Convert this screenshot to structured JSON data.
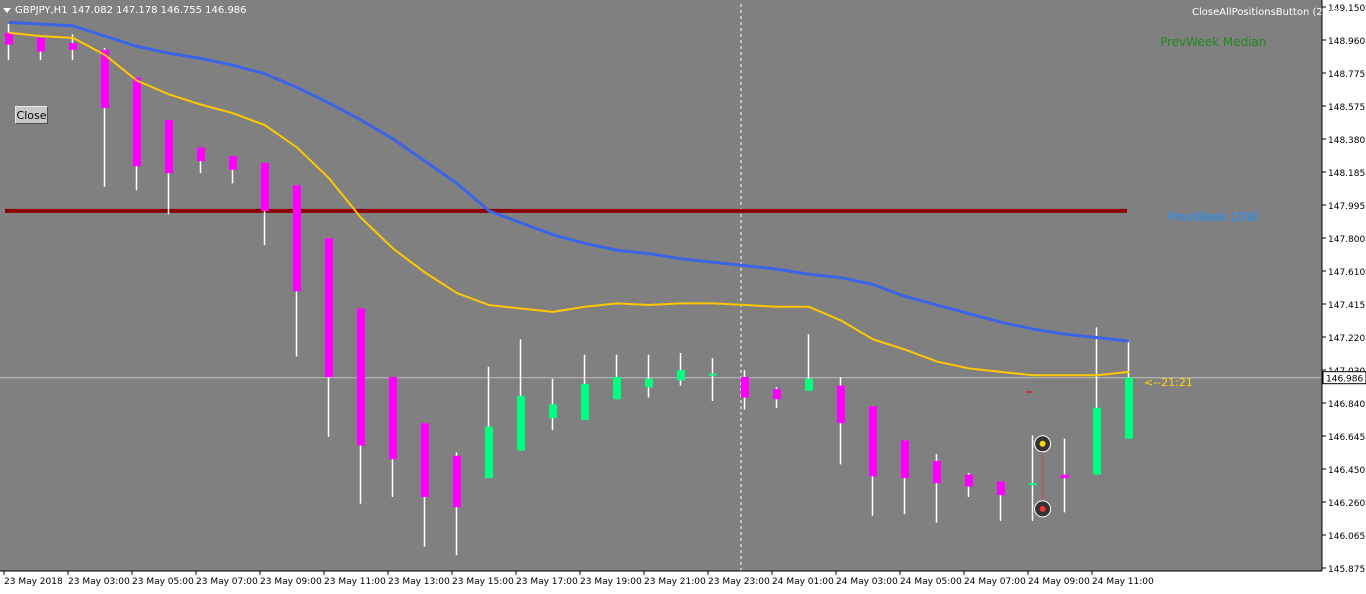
{
  "header": {
    "symbol": "GBPJPY,H1",
    "ohlc": "147.082 147.178 146.755 146.986"
  },
  "buttons": {
    "close_label": "Close",
    "close_all_label": "CloseAllPositionsButton (2)"
  },
  "labels": {
    "prev_week_median": "PrevWeek Median",
    "prev_week_low": "PrevWeek LOW",
    "bar_timer": "<--21:21"
  },
  "colors": {
    "background": "#808080",
    "bull": "#00ff7f",
    "bear": "#ff00ff",
    "wick": "#ffffff",
    "ma_fast": "#ffc800",
    "ma_slow": "#3c64e6",
    "prev_week_low_line": "#8b0000",
    "bid_line": "#c0c0c0",
    "axis_bg": "#ffffff"
  },
  "chart_data": {
    "type": "candlestick",
    "timeframe": "H1",
    "ylim": [
      145.875,
      149.15
    ],
    "y_ticks": [
      "149.150",
      "148.960",
      "148.775",
      "148.575",
      "148.380",
      "148.185",
      "147.995",
      "147.800",
      "147.610",
      "147.415",
      "147.220",
      "147.030",
      "146.840",
      "146.645",
      "146.450",
      "146.260",
      "146.065",
      "145.875"
    ],
    "x_tick_labels": [
      "23 May 2018",
      "23 May 03:00",
      "23 May 05:00",
      "23 May 07:00",
      "23 May 09:00",
      "23 May 11:00",
      "23 May 13:00",
      "23 May 15:00",
      "23 May 17:00",
      "23 May 19:00",
      "23 May 21:00",
      "23 May 23:00",
      "24 May 01:00",
      "24 May 03:00",
      "24 May 05:00",
      "24 May 07:00",
      "24 May 09:00",
      "24 May 11:00"
    ],
    "current_price": "146.986",
    "prev_week_low": 147.96,
    "candles": [
      {
        "o": 149.0,
        "h": 149.05,
        "l": 148.84,
        "c": 148.93
      },
      {
        "o": 148.97,
        "h": 148.97,
        "l": 148.84,
        "c": 148.89
      },
      {
        "o": 148.94,
        "h": 148.99,
        "l": 148.84,
        "c": 148.9
      },
      {
        "o": 148.9,
        "h": 148.91,
        "l": 148.1,
        "c": 148.56
      },
      {
        "o": 148.74,
        "h": 148.74,
        "l": 148.08,
        "c": 148.22
      },
      {
        "o": 148.49,
        "h": 148.49,
        "l": 147.94,
        "c": 148.18
      },
      {
        "o": 148.33,
        "h": 148.33,
        "l": 148.18,
        "c": 148.25
      },
      {
        "o": 148.28,
        "h": 148.28,
        "l": 148.12,
        "c": 148.2
      },
      {
        "o": 148.24,
        "h": 148.24,
        "l": 147.76,
        "c": 147.96
      },
      {
        "o": 148.11,
        "h": 148.11,
        "l": 147.11,
        "c": 147.49
      },
      {
        "o": 147.8,
        "h": 147.8,
        "l": 146.64,
        "c": 146.99
      },
      {
        "o": 147.39,
        "h": 147.39,
        "l": 146.25,
        "c": 146.59
      },
      {
        "o": 146.99,
        "h": 146.99,
        "l": 146.29,
        "c": 146.51
      },
      {
        "o": 146.72,
        "h": 146.72,
        "l": 146.0,
        "c": 146.29
      },
      {
        "o": 146.53,
        "h": 146.55,
        "l": 145.95,
        "c": 146.23
      },
      {
        "o": 146.4,
        "h": 147.05,
        "l": 146.4,
        "c": 146.7
      },
      {
        "o": 146.56,
        "h": 147.21,
        "l": 146.56,
        "c": 146.88
      },
      {
        "o": 146.75,
        "h": 146.98,
        "l": 146.68,
        "c": 146.83
      },
      {
        "o": 146.74,
        "h": 147.12,
        "l": 146.74,
        "c": 146.95
      },
      {
        "o": 146.86,
        "h": 147.12,
        "l": 146.86,
        "c": 146.99
      },
      {
        "o": 146.93,
        "h": 147.12,
        "l": 146.87,
        "c": 146.98
      },
      {
        "o": 146.97,
        "h": 147.13,
        "l": 146.94,
        "c": 147.03
      },
      {
        "o": 147.0,
        "h": 147.1,
        "l": 146.85,
        "c": 147.01
      },
      {
        "o": 146.99,
        "h": 147.03,
        "l": 146.8,
        "c": 146.87
      },
      {
        "o": 146.92,
        "h": 146.93,
        "l": 146.81,
        "c": 146.86
      },
      {
        "o": 146.91,
        "h": 147.24,
        "l": 146.91,
        "c": 146.98
      },
      {
        "o": 146.94,
        "h": 146.99,
        "l": 146.48,
        "c": 146.72
      },
      {
        "o": 146.82,
        "h": 146.82,
        "l": 146.18,
        "c": 146.41
      },
      {
        "o": 146.62,
        "h": 146.62,
        "l": 146.19,
        "c": 146.4
      },
      {
        "o": 146.5,
        "h": 146.54,
        "l": 146.14,
        "c": 146.37
      },
      {
        "o": 146.42,
        "h": 146.43,
        "l": 146.29,
        "c": 146.35
      },
      {
        "o": 146.38,
        "h": 146.38,
        "l": 146.15,
        "c": 146.3
      },
      {
        "o": 146.36,
        "h": 146.65,
        "l": 146.15,
        "c": 146.37
      },
      {
        "o": 146.42,
        "h": 146.63,
        "l": 146.2,
        "c": 146.4
      },
      {
        "o": 146.42,
        "h": 147.28,
        "l": 146.42,
        "c": 146.81
      },
      {
        "o": 146.63,
        "h": 147.21,
        "l": 146.63,
        "c": 146.986
      }
    ],
    "series": [
      {
        "type": "line",
        "values": [
          149.0,
          148.98,
          148.97,
          148.87,
          148.72,
          148.64,
          148.58,
          148.53,
          148.46,
          148.33,
          148.15,
          147.92,
          147.74,
          147.6,
          147.48,
          147.41,
          147.39,
          147.37,
          147.4,
          147.42,
          147.41,
          147.42,
          147.42,
          147.41,
          147.4,
          147.4,
          147.32,
          147.21,
          147.15,
          147.08,
          147.04,
          147.02,
          147.0,
          147.0,
          147.0,
          147.02
        ]
      },
      {
        "type": "line",
        "values": [
          149.06,
          149.05,
          149.04,
          148.98,
          148.92,
          148.88,
          148.85,
          148.81,
          148.76,
          148.68,
          148.59,
          148.49,
          148.38,
          148.25,
          148.12,
          147.96,
          147.89,
          147.82,
          147.77,
          147.73,
          147.71,
          147.68,
          147.66,
          147.64,
          147.62,
          147.59,
          147.57,
          147.53,
          147.46,
          147.41,
          147.36,
          147.31,
          147.27,
          147.24,
          147.22,
          147.2
        ]
      }
    ],
    "trade_markers": [
      {
        "x_index": 32.3,
        "price": 146.6,
        "kind": "open"
      },
      {
        "x_index": 32.3,
        "price": 146.22,
        "kind": "close"
      }
    ]
  }
}
